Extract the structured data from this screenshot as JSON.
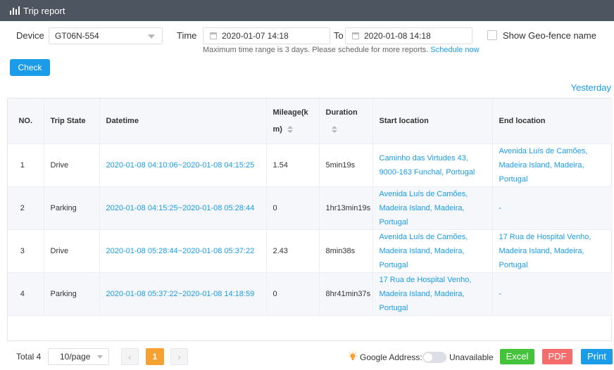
{
  "header": {
    "title": "Trip report",
    "icon": "bar-chart-icon"
  },
  "filters": {
    "device_label": "Device",
    "device_value": "GT06N-554",
    "time_label": "Time",
    "from_value": "2020-01-07 14:18",
    "to_label": "To",
    "to_value": "2020-01-08 14:18",
    "geofence_label": "Show Geo-fence name",
    "hint_text": "Maximum time range is 3 days. Please schedule for more reports.",
    "schedule_link": "Schedule now",
    "check_button": "Check",
    "yesterday_link": "Yesterday"
  },
  "table": {
    "columns": {
      "no": "NO.",
      "state": "Trip State",
      "datetime": "Datetime",
      "mileage_1": "Mileage(k",
      "mileage_2": "m)",
      "duration": "Duration",
      "start": "Start location",
      "end": "End location"
    },
    "rows": [
      {
        "no": "1",
        "state": "Drive",
        "datetime": "2020-01-08 04:10:06~2020-01-08 04:15:25",
        "mileage": "1.54",
        "duration": "5min19s",
        "start": "Caminho das Virtudes 43, 9000-163 Funchal, Portugal",
        "end": "Avenida Luís de Camões, Madeira Island, Madeira, Portugal"
      },
      {
        "no": "2",
        "state": "Parking",
        "datetime": "2020-01-08 04:15:25~2020-01-08 05:28:44",
        "mileage": "0",
        "duration": "1hr13min19s",
        "start": "Avenida Luís de Camões, Madeira Island, Madeira, Portugal",
        "end": "-"
      },
      {
        "no": "3",
        "state": "Drive",
        "datetime": "2020-01-08 05:28:44~2020-01-08 05:37:22",
        "mileage": "2.43",
        "duration": "8min38s",
        "start": "Avenida Luís de Camões, Madeira Island, Madeira, Portugal",
        "end": "17 Rua de Hospital Venho, Madeira Island, Madeira, Portugal"
      },
      {
        "no": "4",
        "state": "Parking",
        "datetime": "2020-01-08 05:37:22~2020-01-08 14:18:59",
        "mileage": "0",
        "duration": "8hr41min37s",
        "start": "17 Rua de Hospital Venho, Madeira Island, Madeira, Portugal",
        "end": "-"
      }
    ]
  },
  "footer": {
    "total": "Total 4",
    "page_size": "10/page",
    "prev": "‹",
    "current_page": "1",
    "next": "›",
    "google_address_label": "Google Address:",
    "unavailable": "Unavailable",
    "excel": "Excel",
    "pdf": "PDF",
    "print": "Print"
  },
  "colors": {
    "accent": "#1a9ce8",
    "titlebar": "#4d5660",
    "excel": "#44c33b",
    "pdf": "#f56c6c",
    "page_current": "#f7a133"
  }
}
